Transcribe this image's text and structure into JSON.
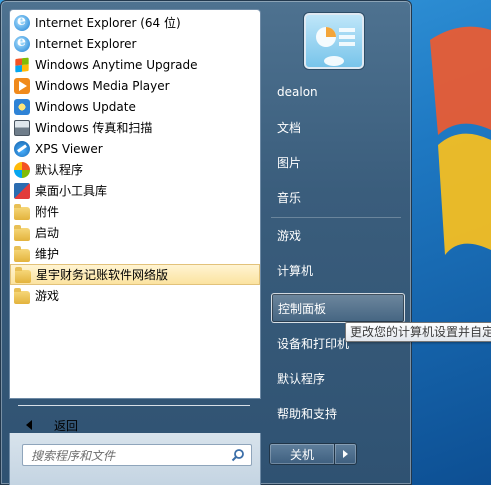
{
  "programs": [
    {
      "label": "Internet Explorer (64 位)",
      "icon": "internet-explorer-icon",
      "selected": false
    },
    {
      "label": "Internet Explorer",
      "icon": "internet-explorer-icon",
      "selected": false
    },
    {
      "label": "Windows Anytime Upgrade",
      "icon": "windows-logo-icon",
      "selected": false
    },
    {
      "label": "Windows Media Player",
      "icon": "media-player-icon",
      "selected": false
    },
    {
      "label": "Windows Update",
      "icon": "windows-update-icon",
      "selected": false
    },
    {
      "label": "Windows 传真和扫描",
      "icon": "fax-scan-icon",
      "selected": false
    },
    {
      "label": "XPS Viewer",
      "icon": "xps-viewer-icon",
      "selected": false
    },
    {
      "label": "默认程序",
      "icon": "default-programs-icon",
      "selected": false
    },
    {
      "label": "桌面小工具库",
      "icon": "gadget-gallery-icon",
      "selected": false
    },
    {
      "label": "附件",
      "icon": "folder-icon",
      "selected": false
    },
    {
      "label": "启动",
      "icon": "folder-icon",
      "selected": false
    },
    {
      "label": "维护",
      "icon": "folder-icon",
      "selected": false
    },
    {
      "label": "星宇财务记账软件网络版",
      "icon": "folder-icon",
      "selected": true
    },
    {
      "label": "游戏",
      "icon": "folder-icon",
      "selected": false
    }
  ],
  "back": {
    "label": "返回"
  },
  "search": {
    "placeholder": "搜索程序和文件"
  },
  "right_items": {
    "user": "dealon",
    "documents": "文档",
    "pictures": "图片",
    "music": "音乐",
    "games": "游戏",
    "computer": "计算机",
    "control_panel": "控制面板",
    "devices_printers": "设备和打印机",
    "default_programs": "默认程序",
    "help_support": "帮助和支持"
  },
  "shutdown": {
    "label": "关机"
  },
  "tooltip": {
    "text": "更改您的计算机设置并自定"
  },
  "colors": {
    "selected_bg": "#fbe3a0",
    "menu_frame": "#3a5d7c",
    "desktop": "#1e78c2"
  }
}
